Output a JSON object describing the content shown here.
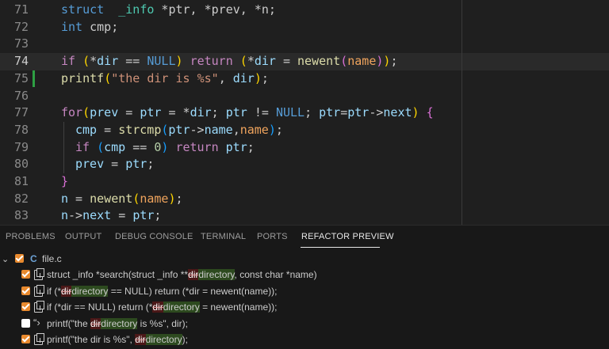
{
  "editor": {
    "lines": [
      {
        "num": "71",
        "parts": [
          [
            "k",
            "struct"
          ],
          [
            "",
            "  "
          ],
          [
            "t",
            "_info"
          ],
          [
            "",
            " *ptr, *prev, *n;"
          ]
        ]
      },
      {
        "num": "72",
        "parts": [
          [
            "k",
            "int"
          ],
          [
            "",
            " cmp;"
          ]
        ]
      },
      {
        "num": "73",
        "parts": []
      },
      {
        "num": "74",
        "parts": [
          [
            "kc",
            "if"
          ],
          [
            "",
            ""
          ],
          [
            "p1",
            " ("
          ],
          [
            "",
            "*"
          ],
          [
            "v",
            "dir"
          ],
          [
            "",
            " == "
          ],
          [
            "k",
            "NULL"
          ],
          [
            "p1",
            ")"
          ],
          [
            "",
            " "
          ],
          [
            "kc",
            "return"
          ],
          [
            "p1",
            " ("
          ],
          [
            "",
            "*"
          ],
          [
            "v",
            "dir"
          ],
          [
            "",
            " = "
          ],
          [
            "f",
            "newent"
          ],
          [
            "p2",
            "("
          ],
          [
            "fn-or",
            "name"
          ],
          [
            "p2",
            ")"
          ],
          [
            "p1",
            ")"
          ],
          [
            "",
            ";"
          ]
        ]
      },
      {
        "num": "75",
        "parts": [
          [
            "f",
            "printf"
          ],
          [
            "p1",
            "("
          ],
          [
            "s",
            "\"the dir is %s\""
          ],
          [
            "",
            ", "
          ],
          [
            "v",
            "dir"
          ],
          [
            "p1",
            ")"
          ],
          [
            "",
            ";"
          ]
        ]
      },
      {
        "num": "76",
        "parts": []
      },
      {
        "num": "77",
        "parts": [
          [
            "kc",
            "for"
          ],
          [
            "p1",
            "("
          ],
          [
            "v",
            "prev"
          ],
          [
            "",
            " = "
          ],
          [
            "v",
            "ptr"
          ],
          [
            "",
            " = *"
          ],
          [
            "v",
            "dir"
          ],
          [
            "",
            "; "
          ],
          [
            "v",
            "ptr"
          ],
          [
            "",
            " != "
          ],
          [
            "k",
            "NULL"
          ],
          [
            "",
            "; "
          ],
          [
            "v",
            "ptr"
          ],
          [
            "",
            "="
          ],
          [
            "v",
            "ptr"
          ],
          [
            "",
            "->"
          ],
          [
            "v",
            "next"
          ],
          [
            "p1",
            ")"
          ],
          [
            "",
            " "
          ],
          [
            "p2",
            "{"
          ]
        ]
      },
      {
        "num": "78",
        "parts": [
          [
            "v",
            "cmp"
          ],
          [
            "",
            " = "
          ],
          [
            "f",
            "strcmp"
          ],
          [
            "p3",
            "("
          ],
          [
            "v",
            "ptr"
          ],
          [
            "",
            "->"
          ],
          [
            "v",
            "name"
          ],
          [
            "",
            ","
          ],
          [
            "fn-or",
            "name"
          ],
          [
            "p3",
            ")"
          ],
          [
            "",
            ";"
          ]
        ],
        "indent": true
      },
      {
        "num": "79",
        "parts": [
          [
            "kc",
            "if"
          ],
          [
            "p3",
            " ("
          ],
          [
            "v",
            "cmp"
          ],
          [
            "",
            " == "
          ],
          [
            "n",
            "0"
          ],
          [
            "p3",
            ")"
          ],
          [
            "",
            " "
          ],
          [
            "kc",
            "return"
          ],
          [
            "",
            " "
          ],
          [
            "v",
            "ptr"
          ],
          [
            "",
            ";"
          ]
        ],
        "indent": true
      },
      {
        "num": "80",
        "parts": [
          [
            "v",
            "prev"
          ],
          [
            "",
            " = "
          ],
          [
            "v",
            "ptr"
          ],
          [
            "",
            ";"
          ]
        ],
        "indent": true
      },
      {
        "num": "81",
        "parts": [
          [
            "p2",
            "}"
          ]
        ]
      },
      {
        "num": "82",
        "parts": [
          [
            "v",
            "n"
          ],
          [
            "",
            " = "
          ],
          [
            "f",
            "newent"
          ],
          [
            "p1",
            "("
          ],
          [
            "fn-or",
            "name"
          ],
          [
            "p1",
            ")"
          ],
          [
            "",
            ";"
          ]
        ]
      },
      {
        "num": "83",
        "parts": [
          [
            "v",
            "n"
          ],
          [
            "",
            "->"
          ],
          [
            "v",
            "next"
          ],
          [
            "",
            " = "
          ],
          [
            "v",
            "ptr"
          ],
          [
            "",
            ";"
          ]
        ]
      }
    ]
  },
  "panel": {
    "tabs": [
      "PROBLEMS",
      "OUTPUT",
      "DEBUG CONSOLE",
      "TERMINAL",
      "PORTS",
      "REFACTOR PREVIEW"
    ],
    "active_tab": "REFACTOR PREVIEW",
    "file": {
      "icon": "C",
      "name": "file.c"
    },
    "changes": [
      {
        "checked": true,
        "kind": "edit",
        "segs": [
          [
            "",
            "struct _info *search(struct _info **"
          ],
          [
            "del",
            "dir"
          ],
          [
            "ins",
            "directory"
          ],
          [
            "",
            ", const char *name)"
          ]
        ]
      },
      {
        "checked": true,
        "kind": "edit",
        "segs": [
          [
            "",
            "if (*"
          ],
          [
            "del",
            "dir"
          ],
          [
            "ins",
            "directory"
          ],
          [
            "",
            " == NULL) return (*dir = newent(name));"
          ]
        ]
      },
      {
        "checked": true,
        "kind": "edit",
        "segs": [
          [
            "",
            "if (*dir == NULL) return (*"
          ],
          [
            "del",
            "dir"
          ],
          [
            "ins",
            "directory"
          ],
          [
            "",
            " = newent(name));"
          ]
        ]
      },
      {
        "checked": false,
        "kind": "string",
        "segs": [
          [
            "",
            "printf(\"the "
          ],
          [
            "del",
            "dir"
          ],
          [
            "ins",
            "directory"
          ],
          [
            "",
            " is %s\", dir);"
          ]
        ]
      },
      {
        "checked": true,
        "kind": "edit",
        "segs": [
          [
            "",
            "printf(\"the dir is %s\", "
          ],
          [
            "del",
            "dir"
          ],
          [
            "ins",
            "directory"
          ],
          [
            "",
            ");"
          ]
        ]
      }
    ]
  }
}
